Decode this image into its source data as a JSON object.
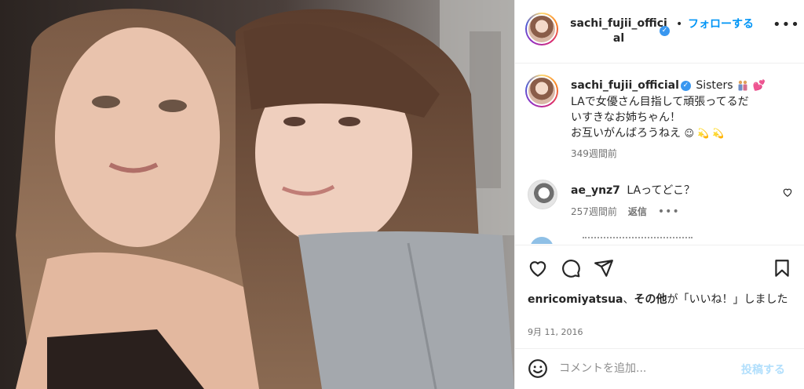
{
  "post": {
    "username": "sachi_fujii_official",
    "follow_label": "フォローする",
    "dot": "•",
    "more_label": "•••"
  },
  "caption": {
    "username": "sachi_fujii_official",
    "text_lead": "Sisters",
    "line2": "LAで女優さん目指して頑張ってるだ",
    "line3": "いすきなお姉ちゃん！",
    "line4": "お互いがんばろうねえ",
    "smile": "☺",
    "dizzy": "💫 💫",
    "heart": "💕",
    "time": "349週間前"
  },
  "comments": [
    {
      "username": "ae_ynz7",
      "text": "LAってどこ？",
      "time": "257週間前",
      "reply_label": "返信",
      "more_label": "•••"
    }
  ],
  "likes": {
    "user": "enricomiyatsua",
    "separator": "、",
    "others": "その他",
    "suffix": "が「いいね！」しました"
  },
  "date": "9月 11, 2016",
  "composer": {
    "placeholder": "コメントを追加...",
    "post_label": "投稿する"
  },
  "colors": {
    "accent": "#0095f6",
    "post_disabled": "#b2dffc",
    "verified": "#3897f0"
  },
  "icons": [
    "verified-badge-icon",
    "more-options-icon",
    "heart-icon",
    "comment-icon",
    "share-icon",
    "bookmark-icon",
    "emoji-icon"
  ]
}
